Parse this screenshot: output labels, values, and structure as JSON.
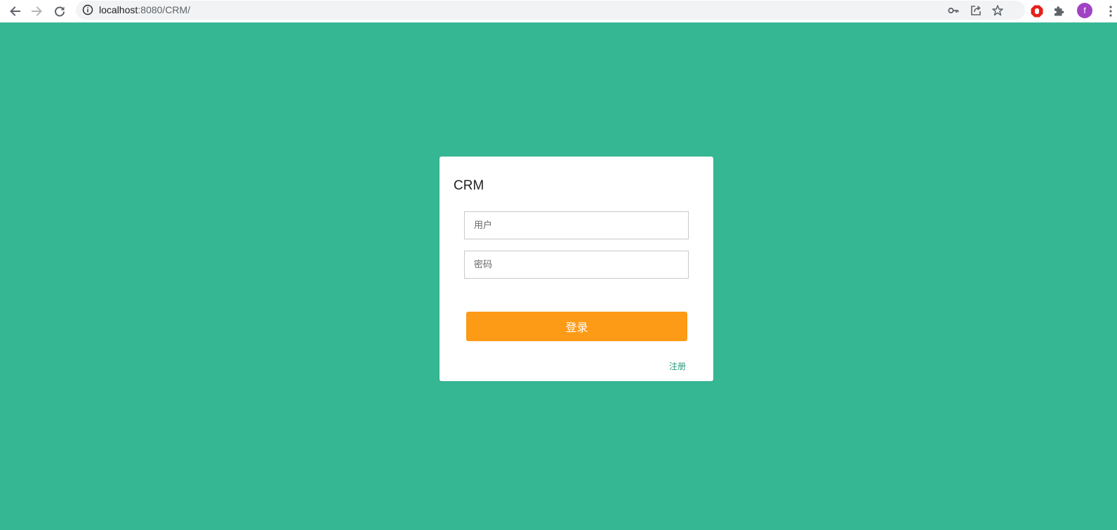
{
  "browser": {
    "url_host": "localhost",
    "url_rest": ":8080/CRM/",
    "profile_initial": "f",
    "icons": [
      "back-icon",
      "forward-icon",
      "reload-icon",
      "site-info-icon",
      "key-icon",
      "share-icon",
      "bookmark-star-icon",
      "adblock-icon",
      "extensions-icon",
      "menu-icon"
    ]
  },
  "colors": {
    "page_background": "#36b794",
    "card_background": "#ffffff",
    "login_button": "#fd9a16",
    "register_link": "#2a9b7e",
    "avatar": "#a142c4"
  },
  "login": {
    "title": "CRM",
    "username_placeholder": "用户",
    "password_placeholder": "密码",
    "submit_label": "登录",
    "register_label": "注册"
  }
}
